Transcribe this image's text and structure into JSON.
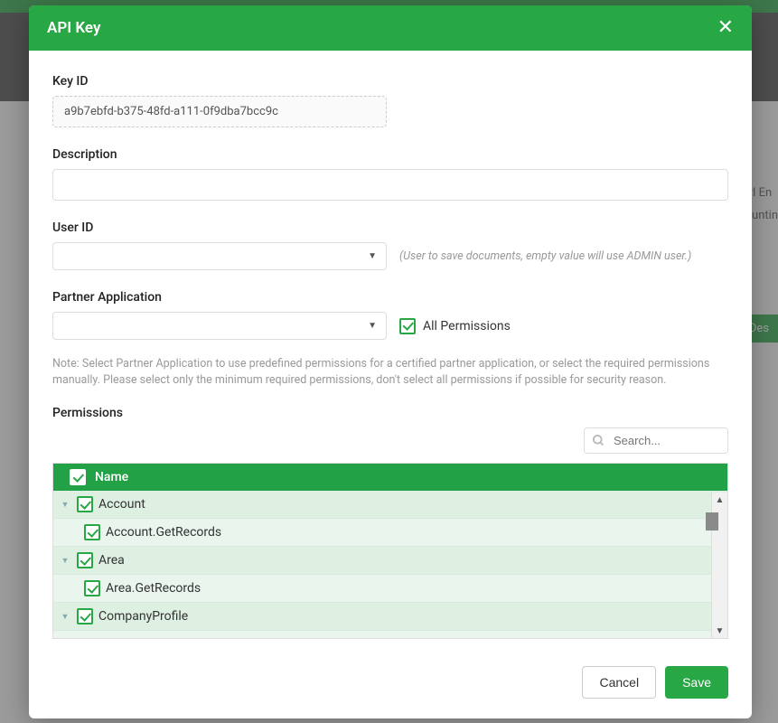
{
  "modal": {
    "title": "API Key",
    "key_id_label": "Key ID",
    "key_id_value": "a9b7ebfd-b375-48fd-a111-0f9dba7bcc9c",
    "description_label": "Description",
    "description_value": "",
    "user_id_label": "User ID",
    "user_id_value": "",
    "user_id_hint": "(User to save documents, empty value will use ADMIN user.)",
    "partner_app_label": "Partner Application",
    "partner_app_value": "",
    "all_permissions_label": "All Permissions",
    "all_permissions_checked": true,
    "note": "Note: Select Partner Application to use predefined permissions for a certified partner application, or select the required permissions manually. Please select only the minimum required permissions, don't select all permissions if possible for security reason.",
    "permissions_label": "Permissions",
    "search_placeholder": "Search...",
    "grid_header_name": "Name",
    "rows": [
      {
        "type": "parent",
        "checked": true,
        "label": "Account"
      },
      {
        "type": "child",
        "checked": true,
        "label": "Account.GetRecords"
      },
      {
        "type": "parent",
        "checked": true,
        "label": "Area"
      },
      {
        "type": "child",
        "checked": true,
        "label": "Area.GetRecords"
      },
      {
        "type": "parent",
        "checked": true,
        "label": "CompanyProfile"
      }
    ],
    "cancel_label": "Cancel",
    "save_label": "Save"
  },
  "background": {
    "col1": "PI En",
    "col2": "ountin",
    "button": "Des"
  }
}
